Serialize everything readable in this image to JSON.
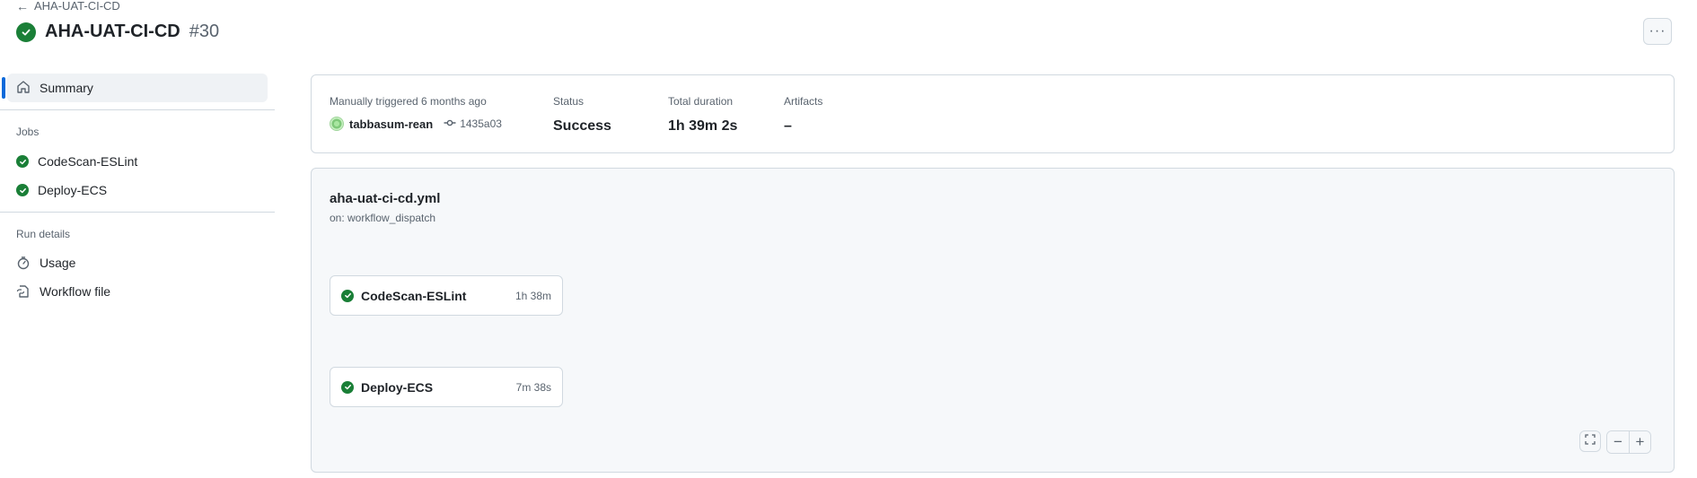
{
  "header": {
    "back_label": "AHA-UAT-CI-CD",
    "title": "AHA-UAT-CI-CD",
    "run_number": "#30",
    "status_color": "#1a7f37",
    "more_label": "···"
  },
  "sidebar": {
    "summary_label": "Summary",
    "jobs_heading": "Jobs",
    "jobs": [
      {
        "label": "CodeScan-ESLint",
        "icon": "check-circle-icon"
      },
      {
        "label": "Deploy-ECS",
        "icon": "check-circle-icon"
      }
    ],
    "run_details_heading": "Run details",
    "details": [
      {
        "label": "Usage",
        "icon": "stopwatch-icon"
      },
      {
        "label": "Workflow file",
        "icon": "file-link-icon"
      }
    ]
  },
  "summary": {
    "trigger_label": "Manually triggered 6 months ago",
    "actor": "tabbasum-rean",
    "commit": "1435a03",
    "status_label": "Status",
    "status_value": "Success",
    "duration_label": "Total duration",
    "duration_value": "1h 39m 2s",
    "artifacts_label": "Artifacts",
    "artifacts_value": "–"
  },
  "workflow": {
    "file": "aha-uat-ci-cd.yml",
    "trigger": "on: workflow_dispatch",
    "jobs": [
      {
        "name": "CodeScan-ESLint",
        "duration": "1h 38m"
      },
      {
        "name": "Deploy-ECS",
        "duration": "7m 38s"
      }
    ]
  },
  "zoom": {
    "zoom_out": "−",
    "zoom_in": "+"
  }
}
